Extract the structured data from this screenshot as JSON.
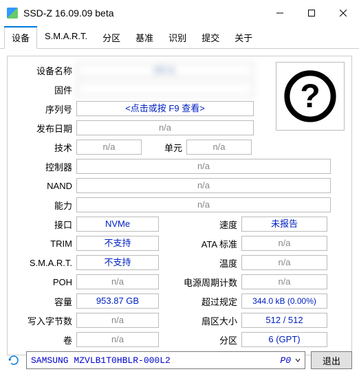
{
  "titlebar": {
    "text": "SSD-Z 16.09.09 beta"
  },
  "tabs": [
    "设备",
    "S.M.A.R.T.",
    "分区",
    "基准",
    "识别",
    "提交",
    "关于"
  ],
  "activeTab": 0,
  "labels": {
    "deviceName": "设备名称",
    "firmware": "固件",
    "serial": "序列号",
    "release": "发布日期",
    "tech": "技术",
    "unit": "单元",
    "controller": "控制器",
    "nand": "NAND",
    "ability": "能力",
    "interface": "接口",
    "speed": "速度",
    "trim": "TRIM",
    "ataStd": "ATA 标准",
    "smart": "S.M.A.R.T.",
    "temp": "温度",
    "poh": "POH",
    "powerCycles": "电源周期计数",
    "capacity": "容量",
    "overprov": "超过规定",
    "writeBytes": "写入字节数",
    "sectorSize": "扇区大小",
    "volume": "卷",
    "partition": "分区"
  },
  "values": {
    "deviceName": "AN                                    )L",
    "firmware": " ",
    "serial": "<点击或按 F9 查看>",
    "release": "n/a",
    "tech": "n/a",
    "unit": "n/a",
    "controller": "n/a",
    "nand": "n/a",
    "ability": "n/a",
    "interface": "NVMe",
    "speed": "未报告",
    "trim": "不支持",
    "ataStd": "n/a",
    "smart": "不支持",
    "temp": "n/a",
    "poh": "n/a",
    "powerCycles": "n/a",
    "capacity": "953.87 GB",
    "overprov": "344.0 kB (0.00%)",
    "writeBytes": "n/a",
    "sectorSize": "512 / 512",
    "volume": "n/a",
    "partition": "6 (GPT)"
  },
  "footer": {
    "device": "SAMSUNG MZVLB1T0HBLR-000L2",
    "slot": "P0",
    "exit": "退出"
  }
}
